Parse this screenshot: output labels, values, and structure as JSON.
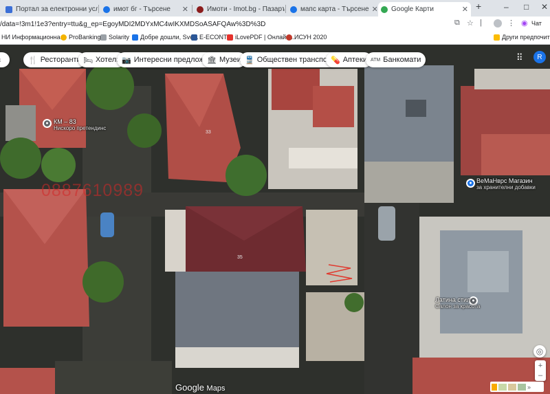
{
  "browser": {
    "tabs": [
      {
        "title": "Портал за електронни услуги на",
        "color": "#3b6fd6"
      },
      {
        "title": "имот бг - Търсене",
        "color": "#1a73e8"
      },
      {
        "title": "Имоти - Imot.bg - Пазарът на нс",
        "color": "#8b1c1c"
      },
      {
        "title": "мапс карта - Търсене",
        "color": "#1a73e8"
      },
      {
        "title": "Google Карти",
        "color": "#34a853"
      }
    ],
    "new_tab": "+",
    "window_controls": [
      "–",
      "□",
      "✕"
    ],
    "url": "/data=!3m1!1e3?entry=ttu&g_ep=EgoyMDI2MDYxMC4wIKXMDSoASAFQAw%3D%3D",
    "chat_label": "Чат",
    "bookmarks": [
      {
        "label": "НИ Информационна..."
      },
      {
        "label": "ProBanking"
      },
      {
        "label": "Solarity"
      },
      {
        "label": "Добре дошли, Sve..."
      },
      {
        "label": "E-ECONT"
      },
      {
        "label": "iLovePDF | Онлайн..."
      },
      {
        "label": "ИСУН 2020"
      },
      {
        "label": "Други предпочитани"
      }
    ]
  },
  "map": {
    "chips": [
      {
        "label": "Ресторанти",
        "icon": "🍴"
      },
      {
        "label": "Хотели",
        "icon": "🛏"
      },
      {
        "label": "Интересни предложен...",
        "icon": "📷"
      },
      {
        "label": "Музеи",
        "icon": "🏛"
      },
      {
        "label": "Обществен транспорт",
        "icon": "🚆"
      },
      {
        "label": "Аптеки",
        "icon": "💊"
      },
      {
        "label": "Банкомати",
        "icon": "ATM"
      }
    ],
    "avatar": "R",
    "pois": [
      {
        "name": "КМ – 83",
        "sub": "Нискоро претендинс"
      },
      {
        "name": "ВеМаНврс Магазин",
        "sub": "за хранителни добавки"
      },
      {
        "name": "Латина стил",
        "sub": "Салон за красота"
      }
    ],
    "building_numbers": [
      "33",
      "35"
    ],
    "watermark": "0887610989",
    "logo_google": "Google",
    "logo_maps": "Maps"
  }
}
